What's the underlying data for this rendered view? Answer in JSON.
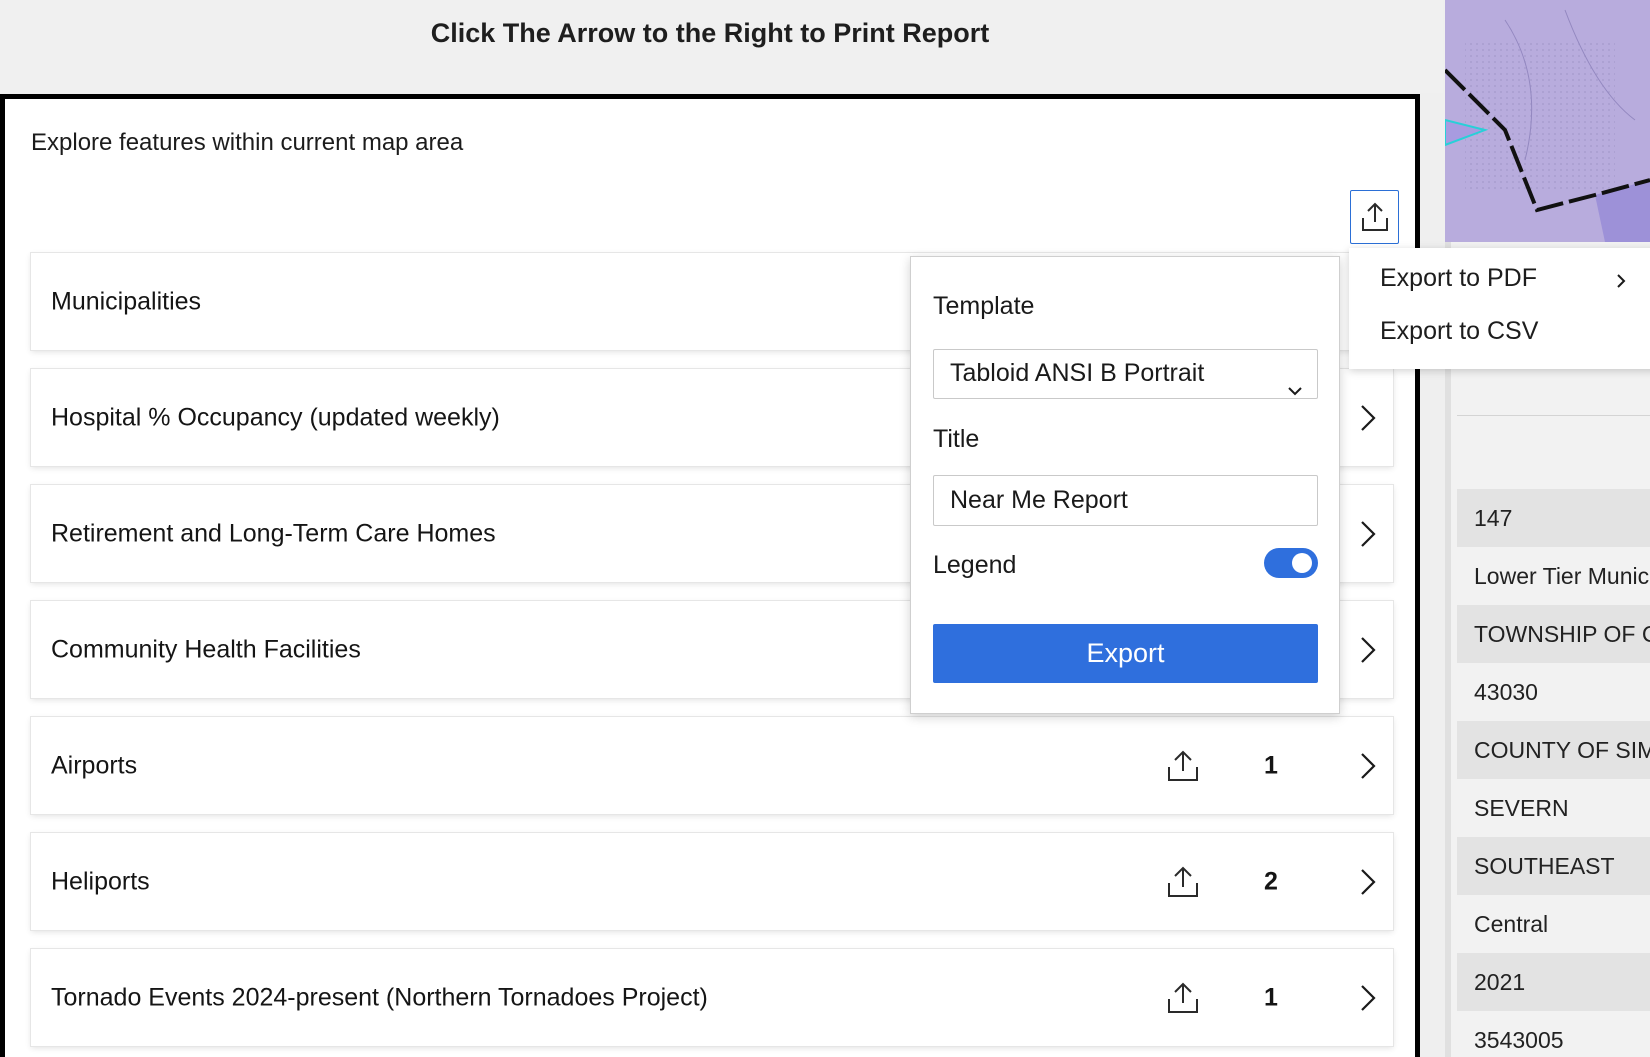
{
  "header": {
    "title": "Click The Arrow to the Right to Print Report"
  },
  "panel": {
    "subtitle": "Explore features within current map area",
    "export_icon": "share-export-icon"
  },
  "layers": [
    {
      "label": "Municipalities",
      "count": ""
    },
    {
      "label": "Hospital % Occupancy (updated weekly)",
      "count": ""
    },
    {
      "label": "Retirement and Long-Term Care Homes",
      "count": ""
    },
    {
      "label": "Community Health Facilities",
      "count": ""
    },
    {
      "label": "Airports",
      "count": "1"
    },
    {
      "label": "Heliports",
      "count": "2"
    },
    {
      "label": "Tornado Events 2024-present (Northern Tornadoes Project)",
      "count": "1"
    }
  ],
  "export_menu": {
    "items": [
      "Export to PDF",
      "Export to CSV"
    ]
  },
  "print_form": {
    "template_label": "Template",
    "template_value": "Tabloid ANSI B Portrait",
    "title_label": "Title",
    "title_value": "Near Me Report",
    "legend_label": "Legend",
    "legend_on": true,
    "export_label": "Export"
  },
  "attributes": {
    "values": [
      "147",
      "Lower Tier Munic",
      "TOWNSHIP OF C",
      "43030",
      "COUNTY OF SIM",
      "SEVERN",
      "SOUTHEAST",
      "Central",
      "2021",
      "3543005"
    ]
  },
  "colors": {
    "accent": "#2f6fdd",
    "map_fill": "#b6a9dc",
    "map_highlight": "#9b8ed6"
  }
}
